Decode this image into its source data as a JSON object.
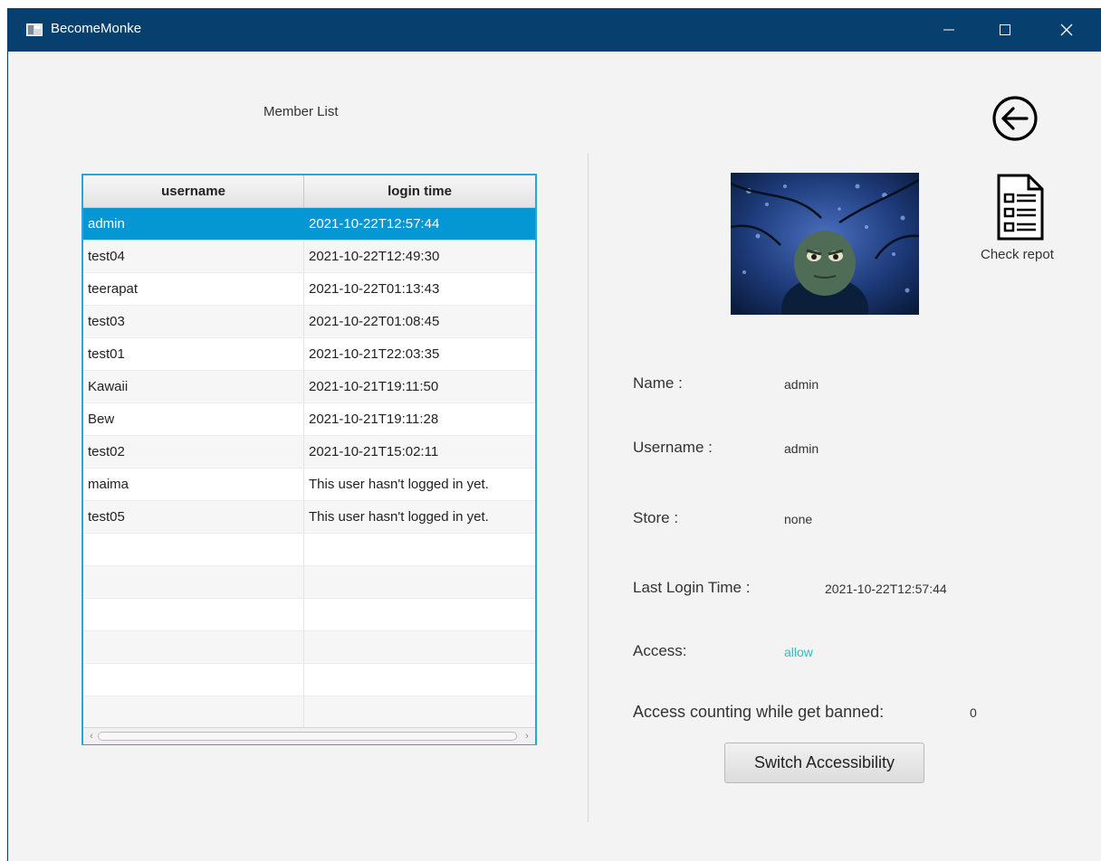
{
  "window": {
    "title": "BecomeMonke"
  },
  "member_list": {
    "title": "Member List",
    "columns": [
      "username",
      "login time"
    ],
    "rows": [
      {
        "username": "admin",
        "login_time": "2021-10-22T12:57:44",
        "selected": true
      },
      {
        "username": "test04",
        "login_time": "2021-10-22T12:49:30"
      },
      {
        "username": "teerapat",
        "login_time": "2021-10-22T01:13:43"
      },
      {
        "username": "test03",
        "login_time": "2021-10-22T01:08:45"
      },
      {
        "username": "test01",
        "login_time": "2021-10-21T22:03:35"
      },
      {
        "username": "Kawaii",
        "login_time": "2021-10-21T19:11:50"
      },
      {
        "username": "Bew",
        "login_time": "2021-10-21T19:11:28"
      },
      {
        "username": "test02",
        "login_time": "2021-10-21T15:02:11"
      },
      {
        "username": "maima",
        "login_time": "This user hasn't logged in yet."
      },
      {
        "username": "test05",
        "login_time": "This user hasn't logged in yet."
      },
      {
        "username": "",
        "login_time": ""
      },
      {
        "username": "",
        "login_time": ""
      },
      {
        "username": "",
        "login_time": ""
      },
      {
        "username": "",
        "login_time": ""
      },
      {
        "username": "",
        "login_time": ""
      },
      {
        "username": "",
        "login_time": ""
      }
    ]
  },
  "actions": {
    "check_report_label": "Check repot",
    "switch_label": "Switch Accessibility"
  },
  "details": {
    "name_label": "Name :",
    "name_value": "admin",
    "username_label": "Username :",
    "username_value": "admin",
    "store_label": "Store :",
    "store_value": "none",
    "last_login_label": "Last Login Time :",
    "last_login_value": "2021-10-22T12:57:44",
    "access_label": "Access:",
    "access_value": "allow",
    "access_count_label": "Access counting while get banned:",
    "access_count_value": "0"
  },
  "colors": {
    "titlebar": "#073f6e",
    "selection": "#0596d4",
    "table_border": "#2aa5d6",
    "access_allow": "#27c4b5"
  }
}
